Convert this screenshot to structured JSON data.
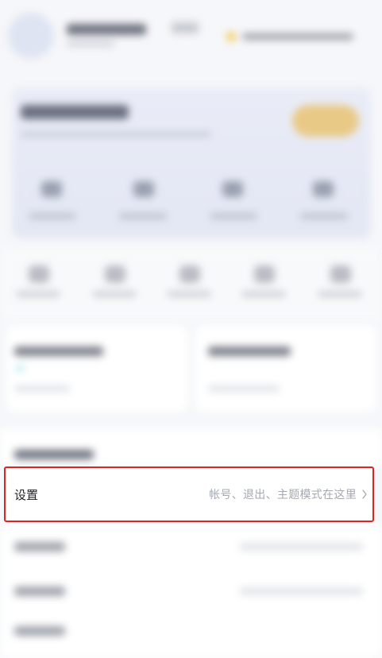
{
  "settings": {
    "label": "设置",
    "description": "帐号、退出、主题模式在这里",
    "chevron_icon": "chevron-right-icon"
  },
  "colors": {
    "highlight_border": "#e0231f",
    "label_text": "#222326",
    "description_text": "#a5a9b2",
    "background": "#f6f7fa",
    "vip_gold": "#f1cc58",
    "member_button": "#e9c986"
  }
}
